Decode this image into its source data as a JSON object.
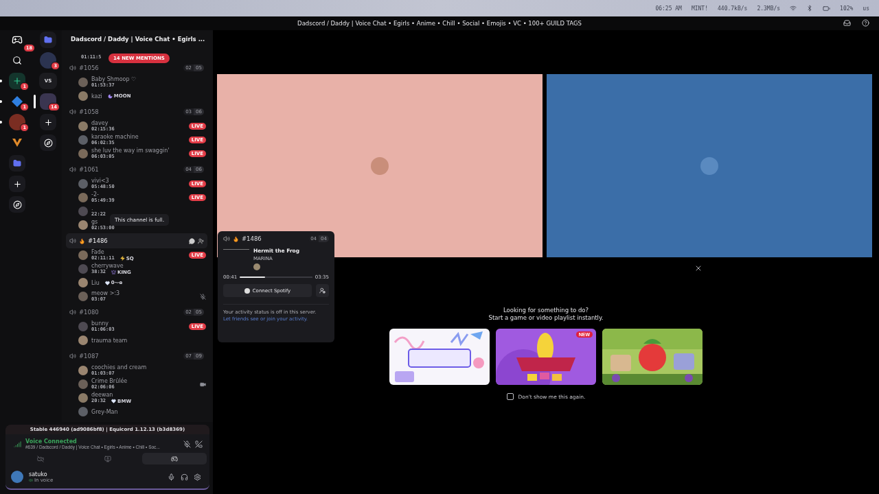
{
  "os_bar": {
    "clock": "06:25 AM",
    "status_text": "MINT!",
    "net_down": "440.7kB/s",
    "net_up": "2.3MB/s",
    "battery": "102%",
    "keyboard": "us"
  },
  "window": {
    "title": "Dadscord / Daddy | Voice Chat • Egirls • Anime • Chill • Social • Emojis • VC • 100+ GUILD TAGS"
  },
  "server_rail": [
    {
      "kind": "home",
      "badge": "18",
      "unread": false
    },
    {
      "kind": "search",
      "unread": false
    },
    {
      "kind": "ring",
      "badge": "1",
      "unread": true
    },
    {
      "kind": "diamond",
      "badge": "1",
      "unread": true
    },
    {
      "kind": "avatar",
      "badge": "1",
      "unread": true
    },
    {
      "kind": "emblem",
      "unread": false
    },
    {
      "kind": "folder",
      "unread": false
    },
    {
      "kind": "add",
      "unread": false
    },
    {
      "kind": "discover",
      "unread": false
    }
  ],
  "folder_rail": [
    {
      "kind": "folder",
      "selected": false
    },
    {
      "kind": "server",
      "badge": "3",
      "selected": false
    },
    {
      "kind": "text",
      "label": "VS",
      "selected": false
    },
    {
      "kind": "server",
      "badge": "14",
      "selected": true
    },
    {
      "kind": "add",
      "selected": false
    },
    {
      "kind": "discover",
      "selected": false
    }
  ],
  "channel_list": {
    "server_name": "Dadscord / Daddy | Voice Chat • Egirls ...",
    "mentions": "14 NEW MENTIONS",
    "tooltip": "This channel is full.",
    "partial_user": {
      "time": "01:11:5"
    },
    "channels": [
      {
        "name": "#1056",
        "fire": false,
        "hovered": false,
        "count": "02",
        "limit": "05",
        "users": [
          {
            "name": "Baby Shmoop ♡",
            "time": "01:53:37"
          },
          {
            "name": "kazi",
            "tag": {
              "kind": "moon",
              "text": "MOON"
            }
          }
        ]
      },
      {
        "name": "#1058",
        "fire": false,
        "hovered": false,
        "count": "03",
        "limit": "06",
        "users": [
          {
            "name": "davey",
            "time": "02:15:36",
            "badge": "LIVE"
          },
          {
            "name": "karaoke machine",
            "time": "06:02:35",
            "badge": "LIVE"
          },
          {
            "name": "she luv the way im swaggin'",
            "time": "06:03:05",
            "badge": "LIVE"
          }
        ]
      },
      {
        "name": "#1061",
        "fire": false,
        "hovered": false,
        "count": "04",
        "limit": "06",
        "users": [
          {
            "name": "vivi<3",
            "time": "05:48:50",
            "badge": "LIVE"
          },
          {
            "name": "-2-",
            "time": "05:49:39",
            "badge": "LIVE"
          },
          {
            "name": ".",
            "time": "22:22"
          },
          {
            "name": "gs",
            "time": "02:53:00"
          }
        ]
      },
      {
        "name": "#1486",
        "fire": true,
        "hovered": true,
        "users": [
          {
            "name": "Fade",
            "time": "02:11:11",
            "tag": {
              "kind": "bolt",
              "text": "SQ"
            },
            "badge": "LIVE"
          },
          {
            "name": "cherrywave",
            "time": "38:32",
            "tag": {
              "kind": "crown",
              "text": "KING"
            }
          },
          {
            "name": "Liu",
            "tag": {
              "kind": "heart",
              "text": "0⁓ɷ"
            }
          },
          {
            "name": "meow >:3",
            "time": "03:07",
            "kind": "muted"
          }
        ]
      },
      {
        "name": "#1080",
        "fire": false,
        "hovered": false,
        "count": "02",
        "limit": "05",
        "users": [
          {
            "name": "bunny",
            "time": "01:06:03",
            "badge": "LIVE"
          },
          {
            "name": "trauma team"
          }
        ]
      },
      {
        "name": "#1087",
        "fire": false,
        "hovered": false,
        "count": "07",
        "limit": "09",
        "users": [
          {
            "name": "coochies and cream",
            "time": "01:03:07"
          },
          {
            "name": "Crime Brûlée",
            "time": "02:06:06",
            "kind": "video"
          },
          {
            "name": "deewan",
            "time": "20:32",
            "tag": {
              "kind": "heart",
              "text": "BMW"
            }
          },
          {
            "name": "Grey-Man"
          }
        ]
      }
    ]
  },
  "voice_panel": {
    "build": "Stable 446940 (ad9086bf8) | Equicord 1.12.13 (b3d8369)",
    "status": "Voice Connected",
    "channel": "#639 / Dadscord / Daddy | Voice Chat • Egirls • Anime • Chill • Soc...",
    "actions": [
      {
        "kind": "camera",
        "selected": false
      },
      {
        "kind": "screen",
        "selected": false
      },
      {
        "kind": "activity",
        "selected": true
      }
    ]
  },
  "user": {
    "name": "satuko",
    "status": "In voice"
  },
  "tiles": [
    {
      "color": "#e8b1a8"
    },
    {
      "color": "#3b6ea8"
    }
  ],
  "popup": {
    "channel": "#1486",
    "count": "04",
    "limit": "04",
    "song": "Hermit the Frog",
    "artist": "MARINA",
    "elapsed": "00:41",
    "duration": "03:35",
    "level": 0.35,
    "button": "Connect Spotify",
    "note": "Your activity status is off in this server.",
    "link": "Let friends see or join your activity."
  },
  "activities": {
    "title": "Looking for something to do?",
    "subtitle": "Start a game or video playlist instantly.",
    "checkbox": {
      "label": "Don't show me this again.",
      "checked": false
    },
    "cards": [
      {
        "kind": "whiteboard"
      },
      {
        "kind": "banana",
        "badge": "NEW"
      },
      {
        "kind": "garden"
      }
    ]
  }
}
